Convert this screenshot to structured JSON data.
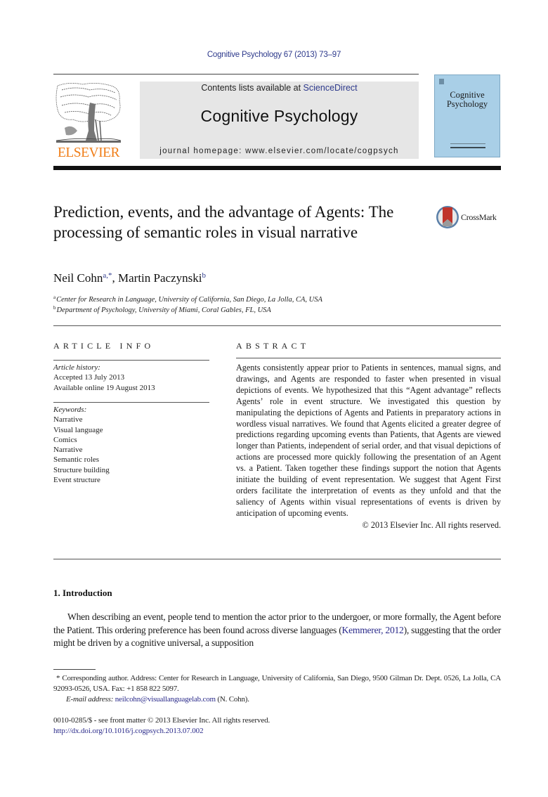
{
  "header": {
    "citation": "Cognitive Psychology 67 (2013) 73–97",
    "contents_prefix": "Contents lists available at ",
    "contents_link": "ScienceDirect",
    "journal_title": "Cognitive Psychology",
    "homepage": "journal homepage: www.elsevier.com/locate/cogpsych",
    "publisher_logo_text": "ELSEVIER",
    "cover_title": "Cognitive Psychology",
    "colors": {
      "publisher_orange": "#f07d17",
      "link_blue": "#2e3a8c",
      "cover_blue": "#a9cfe7",
      "banner_gray": "#e6e6e6"
    }
  },
  "article": {
    "title": "Prediction, events, and the advantage of Agents: The processing of semantic roles in visual narrative",
    "crossmark_label": "CrossMark",
    "authors": [
      {
        "name": "Neil Cohn",
        "affil": "a,*"
      },
      {
        "name": "Martin Paczynski",
        "affil": "b"
      }
    ],
    "author_separator": ", ",
    "affiliations": [
      {
        "mark": "a",
        "text": "Center for Research in Language, University of California, San Diego, La Jolla, CA, USA"
      },
      {
        "mark": "b",
        "text": "Department of Psychology, University of Miami, Coral Gables, FL, USA"
      }
    ]
  },
  "article_info": {
    "heading": "ARTICLE INFO",
    "history_label": "Article history:",
    "history": [
      "Accepted 13 July 2013",
      "Available online 19 August 2013"
    ],
    "keywords_label": "Keywords:",
    "keywords": [
      "Narrative",
      "Visual language",
      "Comics",
      "Narrative",
      "Semantic roles",
      "Structure building",
      "Event structure"
    ]
  },
  "abstract": {
    "heading": "ABSTRACT",
    "body": "Agents consistently appear prior to Patients in sentences, manual signs, and drawings, and Agents are responded to faster when presented in visual depictions of events. We hypothesized that this “Agent advantage” reflects Agents’ role in event structure. We investigated this question by manipulating the depictions of Agents and Patients in preparatory actions in wordless visual narratives. We found that Agents elicited a greater degree of predictions regarding upcoming events than Patients, that Agents are viewed longer than Patients, independent of serial order, and that visual depictions of actions are processed more quickly following the presentation of an Agent vs. a Patient. Taken together these findings support the notion that Agents initiate the building of event representation. We suggest that Agent First orders facilitate the interpretation of events as they unfold and that the saliency of Agents within visual representations of events is driven by anticipation of upcoming events.",
    "copyright": "© 2013 Elsevier Inc. All rights reserved."
  },
  "introduction": {
    "heading": "1. Introduction",
    "text_before_citation": "When describing an event, people tend to mention the actor prior to the undergoer, or more formally, the Agent before the Patient. This ordering preference has been found across diverse languages (",
    "citation": "Kemmerer, 2012",
    "text_after_citation": "), suggesting that the order might be driven by a cognitive universal, a supposition"
  },
  "footnote": {
    "marker": "*",
    "corresponding": "Corresponding author. Address: Center for Research in Language, University of California, San Diego, 9500 Gilman Dr. Dept. 0526, La Jolla, CA 92093-0526, USA. Fax: +1 858 822 5097.",
    "email_label": "E-mail address:",
    "email": "neilcohn@visuallanguagelab.com",
    "email_suffix": " (N. Cohn)."
  },
  "front_matter": {
    "issn_line": "0010-0285/$ - see front matter © 2013 Elsevier Inc. All rights reserved.",
    "doi": "http://dx.doi.org/10.1016/j.cogpsych.2013.07.002"
  }
}
